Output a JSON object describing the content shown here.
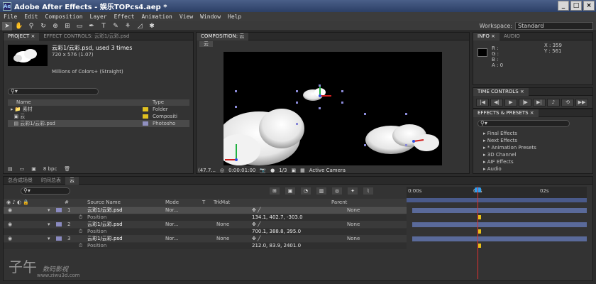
{
  "window": {
    "title": "Adobe After Effects - 娱乐TOPcs4.aep *",
    "icon_text": "Ae"
  },
  "menu": [
    "File",
    "Edit",
    "Composition",
    "Layer",
    "Effect",
    "Animation",
    "View",
    "Window",
    "Help"
  ],
  "workspace": {
    "label": "Workspace:",
    "value": "Standard"
  },
  "project": {
    "tabs": [
      "PROJECT ×",
      "EFFECT CONTROLS: 云彩1/云彩.psd"
    ],
    "selected_name": "云彩1/云彩.psd",
    "used": ", used 3 times",
    "size": "720 x 576 (1.07)",
    "color": "Millions of Colors+ (Straight)",
    "columns": {
      "name": "Name",
      "type": "Type"
    },
    "items": [
      {
        "name": "素材",
        "type": "Folder",
        "color": "#e0c020"
      },
      {
        "name": "云",
        "type": "Compositi",
        "color": "#e0c020"
      },
      {
        "name": "云彩1/云彩.psd",
        "type": "Photosho",
        "color": "#9090c0"
      }
    ],
    "bpc": "8 bpc"
  },
  "composition": {
    "tab": "COMPOSITION: 云",
    "subtab": "云",
    "zoom": "(47.7...",
    "timecode": "0:00:01:00",
    "resolution": "1/3",
    "camera": "Active Camera"
  },
  "info": {
    "tabs": [
      "INFO ×",
      "AUDIO"
    ],
    "rgba": "R :\nG :\nB :\nA : 0",
    "x": "X : 359",
    "y": "Y : 561"
  },
  "time_controls": {
    "tab": "TIME CONTROLS ×"
  },
  "effects": {
    "tab": "EFFECTS & PRESETS ×",
    "items": [
      "Final Effects",
      "Next Effects",
      "* Animation Presets",
      "3D Channel",
      "AIF Effects",
      "Audio"
    ]
  },
  "timeline": {
    "tabs": [
      "总合成场景",
      "时间总表",
      "云"
    ],
    "columns": {
      "num": "#",
      "source": "Source Name",
      "mode": "Mode",
      "t": "T",
      "trkmat": "TrkMat",
      "parent": "Parent"
    },
    "ruler": [
      "0:00s",
      "01s",
      "02s"
    ],
    "layers": [
      {
        "num": "1",
        "name": "云彩1/云彩.psd",
        "mode": "Nor...",
        "trkmat": "",
        "parent": "None",
        "position": "134.1, 402.7, -303.0"
      },
      {
        "num": "2",
        "name": "云彩1/云彩.psd",
        "mode": "Nor...",
        "trkmat": "None",
        "parent": "None",
        "position": "700.1, 388.8, 395.0"
      },
      {
        "num": "3",
        "name": "云彩1/云彩.psd",
        "mode": "Nor...",
        "trkmat": "None",
        "parent": "None",
        "position": "212.0, 83.9, 2401.0"
      }
    ],
    "prop_label": "Position"
  },
  "watermark": {
    "big": "子午",
    "sub": "数码影视",
    "url": "www.ziwu3d.com"
  }
}
